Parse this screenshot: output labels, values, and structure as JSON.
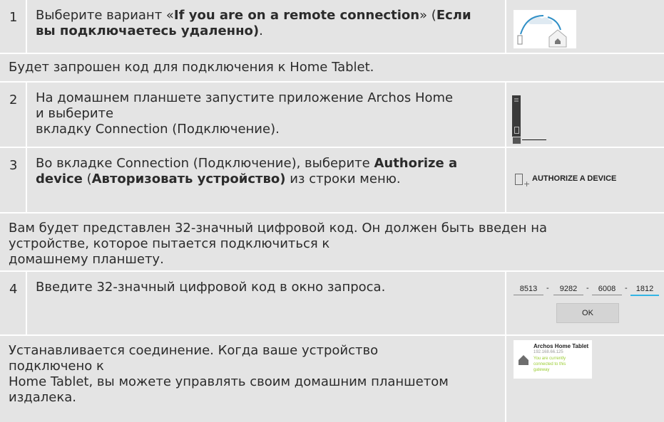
{
  "steps": [
    {
      "number": "1",
      "text_parts": [
        "Выберите вариант «",
        "If you are on a remote connection",
        "» (",
        "Если",
        " ",
        "вы подключаетесь удаленно)",
        "."
      ]
    },
    {
      "number": "2",
      "lines": [
        "На домашнем планшете запустите приложение Archos Home",
        "и выберите",
        "вкладку Connection (Подключение)."
      ]
    },
    {
      "number": "3",
      "text_parts": [
        "Во вкладке Connection (Подключение), выберите ",
        "Authorize a",
        "device",
        " (",
        "Авторизовать устройство)",
        " из строки меню."
      ]
    },
    {
      "number": "4",
      "text": "Введите 32-значный цифровой код в окно запроса."
    }
  ],
  "notes": {
    "code_request": "Будет запрошен код для подключения к Home Tablet.",
    "code_shown": [
      "Вам будет представлен 32-значный цифровой код. Он должен быть введен на",
      "устройстве, которое пытается подключиться к",
      "домашнему планшету."
    ],
    "connected": [
      "Устанавливается соединение. Когда ваше устройство",
      "подключено к",
      "Home Tablet, вы можете управлять своим домашним планшетом",
      "издалека."
    ]
  },
  "thumbnails": {
    "authorize_label": "AUTHORIZE A DEVICE",
    "code_fields": [
      "8513",
      "9282",
      "6008",
      "1812"
    ],
    "code_separator": "-",
    "ok_label": "OK",
    "device_name": "Archos Home Tablet",
    "device_ip": "192.168.66.125",
    "device_status": [
      "You are currently",
      "connected to this",
      "gateway"
    ],
    "accent_color": "#33b5e5",
    "status_color": "#9acd32"
  }
}
